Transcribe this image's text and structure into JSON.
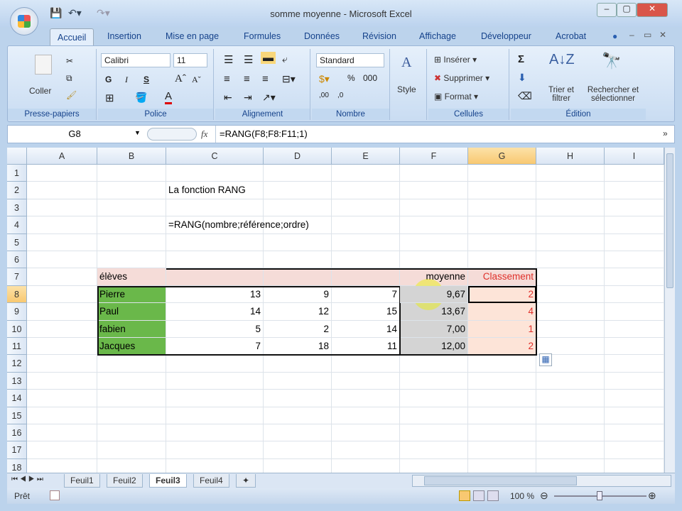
{
  "window": {
    "title": "somme moyenne - Microsoft Excel"
  },
  "tabs": [
    "Accueil",
    "Insertion",
    "Mise en page",
    "Formules",
    "Données",
    "Révision",
    "Affichage",
    "Développeur",
    "Acrobat"
  ],
  "ribbon": {
    "clipboard": {
      "paste": "Coller",
      "label": "Presse-papiers"
    },
    "font": {
      "name": "Calibri",
      "size": "11",
      "bold": "G",
      "italic": "I",
      "underline": "S",
      "label": "Police"
    },
    "alignment": {
      "label": "Alignement"
    },
    "number": {
      "format": "Standard",
      "percent": "%",
      "thousands": "000",
      "label": "Nombre"
    },
    "style": {
      "label": "Style"
    },
    "cells": {
      "insert": "Insérer",
      "delete": "Supprimer",
      "format": "Format",
      "label": "Cellules"
    },
    "editing": {
      "sum": "Σ",
      "sort": "Trier et filtrer",
      "find": "Rechercher et sélectionner",
      "label": "Édition"
    }
  },
  "formula_bar": {
    "name_box": "G8",
    "fx": "fx",
    "formula": "=RANG(F8;F8:F11;1)"
  },
  "columns": [
    "A",
    "B",
    "C",
    "D",
    "E",
    "F",
    "G",
    "H",
    "I"
  ],
  "rows": [
    "1",
    "2",
    "3",
    "4",
    "5",
    "6",
    "7",
    "8",
    "9",
    "10",
    "11",
    "12",
    "13",
    "14",
    "15",
    "16",
    "17",
    "18"
  ],
  "selected": {
    "col": "G",
    "row": "8"
  },
  "cells": {
    "C2": "La fonction RANG",
    "C4": "=RANG(nombre;référence;ordre)",
    "B7": "élèves",
    "F7": "moyenne",
    "G7": "Classement",
    "B8": "Pierre",
    "C8": "13",
    "D8": "9",
    "E8": "7",
    "F8": "9,67",
    "G8": "2",
    "B9": "Paul",
    "C9": "14",
    "D9": "12",
    "E9": "15",
    "F9": "13,67",
    "G9": "4",
    "B10": "fabien",
    "C10": "5",
    "D10": "2",
    "E10": "14",
    "F10": "7,00",
    "G10": "1",
    "B11": "Jacques",
    "C11": "7",
    "D11": "18",
    "E11": "11",
    "F11": "12,00",
    "G11": "2"
  },
  "sheets": [
    "Feuil1",
    "Feuil2",
    "Feuil3",
    "Feuil4"
  ],
  "active_sheet": "Feuil3",
  "status": {
    "ready": "Prêt",
    "zoom": "100 %"
  },
  "colors": {
    "header_row": "#f5dcd8",
    "names": "#6ab84a",
    "average": "#d4d4d4",
    "rank": "#fde4d8",
    "rank_text": "#e0302a"
  }
}
